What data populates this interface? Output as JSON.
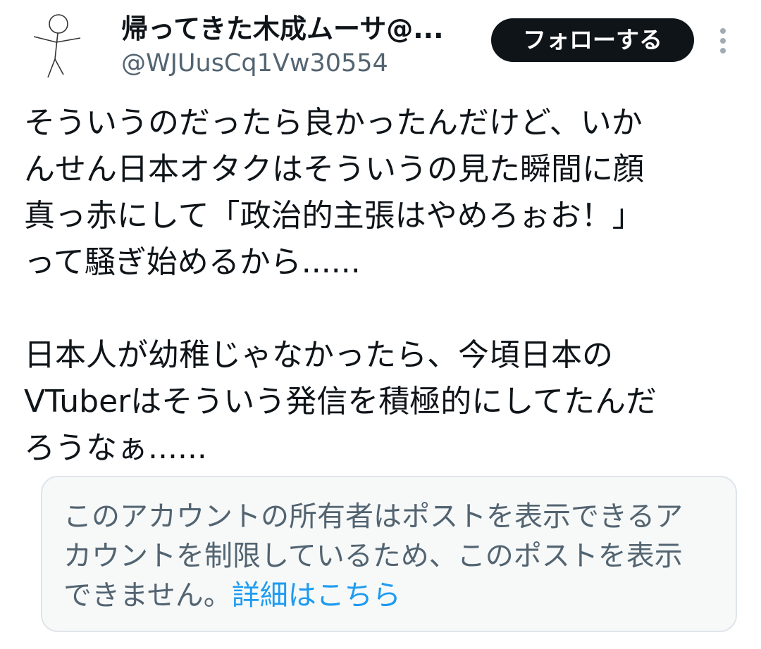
{
  "header": {
    "display_name": "帰ってきた木成ムーサ@...",
    "handle": "@WJUusCq1Vw30554",
    "follow_button_label": "フォローする",
    "more_icon": "more-vertical-icon"
  },
  "post": {
    "paragraphs": [
      [
        "そういうのだったら良かったんだけど、いか",
        "んせん日本オタクはそういうの見た瞬間に顔",
        "真っ赤にして「政治的主張はやめろぉお！」",
        "って騒ぎ始めるから......"
      ],
      [
        "日本人が幼稚じゃなかったら、今頃日本の",
        "VTuberはそういう発信を積極的にしてたんだ",
        "ろうなぁ......"
      ]
    ]
  },
  "notice": {
    "lines": [
      "このアカウントの所有者はポストを表示できるア",
      "カウントを制限しているため、このポストを表示"
    ],
    "last_line_text": "できません。",
    "link_label": "詳細はこちら",
    "link_color": "#1d9bf0"
  },
  "colors": {
    "text_primary": "#0f1419",
    "text_secondary": "#536471",
    "follow_button_bg": "#0f1419",
    "notice_bg": "#f7f9f9"
  }
}
